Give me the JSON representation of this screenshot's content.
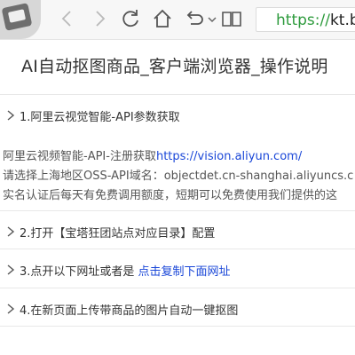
{
  "browser": {
    "url_scheme": "https://",
    "url_host": "kt.bau"
  },
  "page": {
    "title": "AI自动抠图商品_客户端浏览器_操作说明"
  },
  "sections": [
    {
      "label": "1.阿里云视觉智能-API参数获取",
      "expanded": true
    },
    {
      "label": "2.打开【宝塔狂团站点对应目录】配置"
    },
    {
      "label": "3.点开以下网址或者是 ",
      "link": "点击复制下面网址"
    },
    {
      "label": "4.在新页面上传带商品的图片自动一键抠图"
    }
  ],
  "expanded": {
    "line1_text": "阿里云视频智能-API-注册获取",
    "line1_link": "https://vision.aliyun.com/",
    "line2": "请选择上海地区OSS-API域名：objectdet.cn-shanghai.aliyuncs.c",
    "line3": "实名认证后每天有免费调用额度，短期可以免费使用我们提供的这"
  }
}
